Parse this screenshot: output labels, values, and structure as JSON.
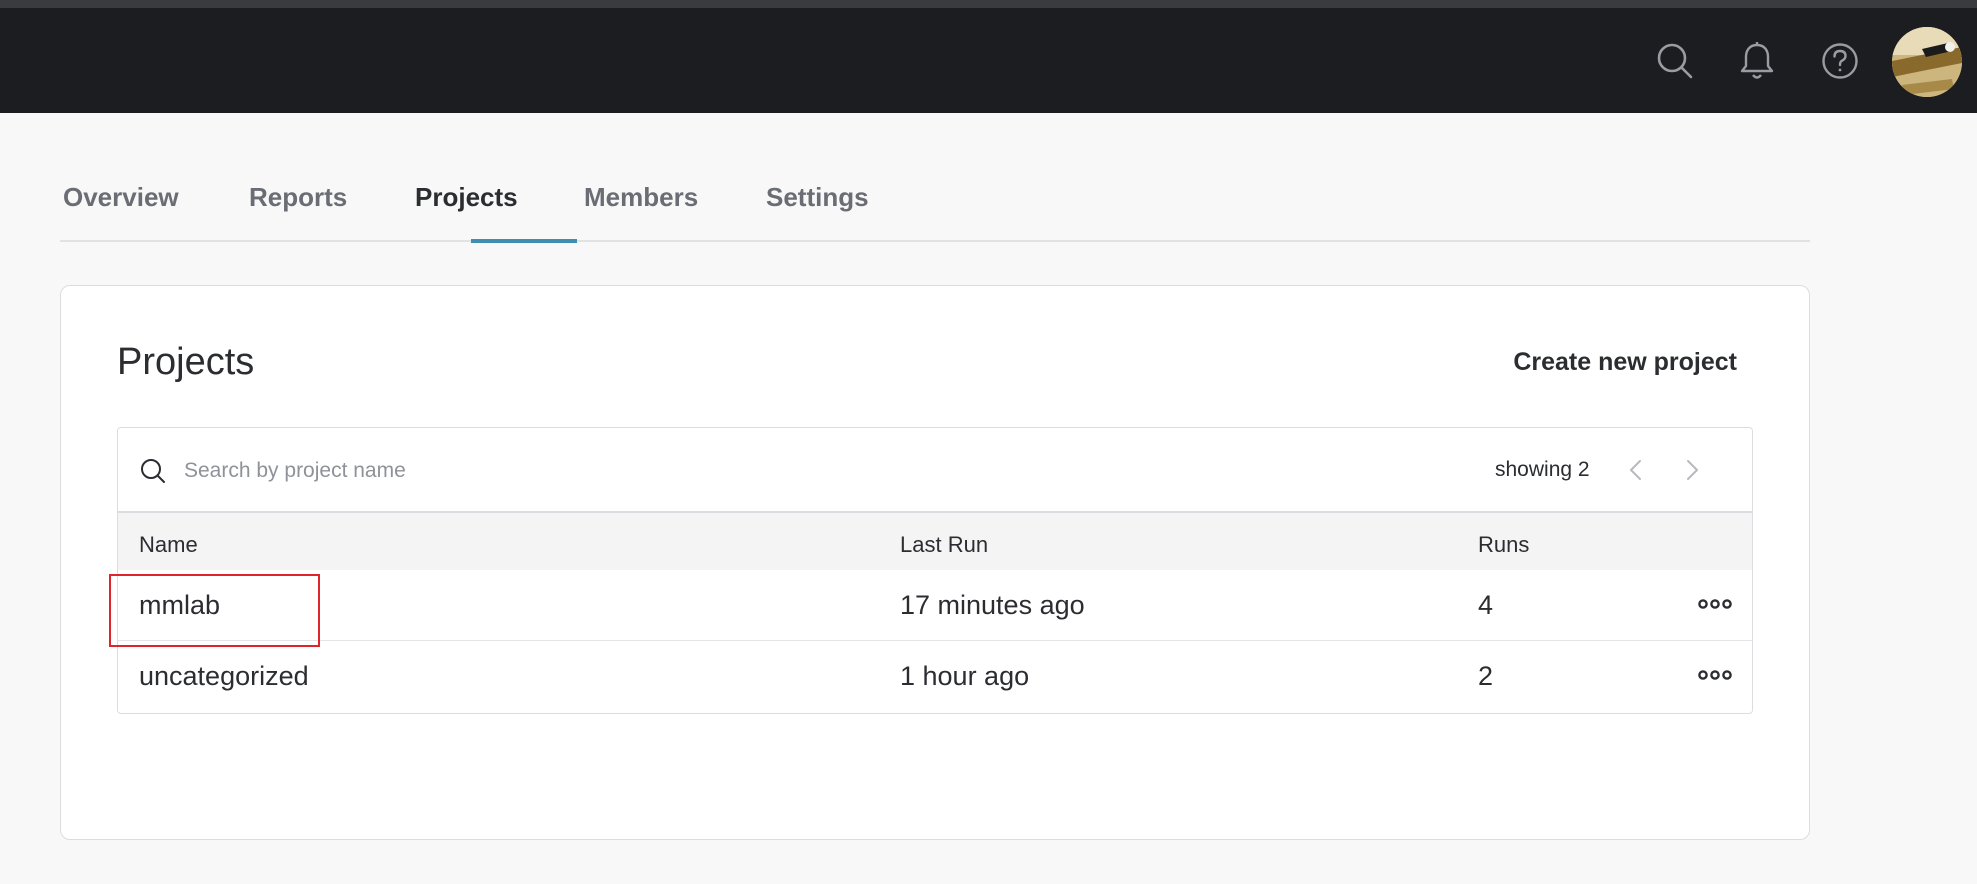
{
  "header": {
    "icons": [
      "search-icon",
      "bell-icon",
      "help-icon"
    ],
    "avatar": "user-avatar"
  },
  "tabs": [
    {
      "label": "Overview",
      "active": false
    },
    {
      "label": "Reports",
      "active": false
    },
    {
      "label": "Projects",
      "active": true
    },
    {
      "label": "Members",
      "active": false
    },
    {
      "label": "Settings",
      "active": false
    }
  ],
  "projects": {
    "title": "Projects",
    "create_label": "Create new project",
    "search_placeholder": "Search by project name",
    "showing": "showing 2",
    "columns": [
      "Name",
      "Last Run",
      "Runs"
    ],
    "rows": [
      {
        "name": "mmlab",
        "last_run": "17 minutes ago",
        "runs": "4"
      },
      {
        "name": "uncategorized",
        "last_run": "1 hour ago",
        "runs": "2"
      }
    ]
  },
  "colors": {
    "topbar": "#1c1d20",
    "tab_accent": "#3f8fb1",
    "highlight": "#e0242b"
  }
}
